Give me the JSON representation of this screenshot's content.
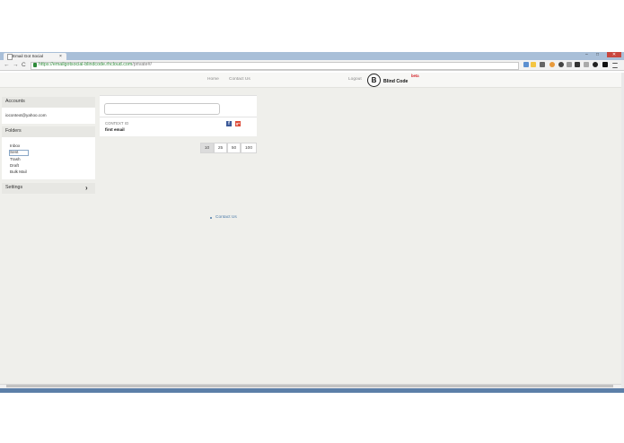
{
  "browser": {
    "tab_title": "Email Got Social",
    "tab_close": "×",
    "window_controls": [
      "–",
      "□"
    ],
    "window_close": "✕",
    "nav": [
      "←",
      "→",
      "C"
    ],
    "url_host": "https://emailgotsocial-blindcode.rhcloud.com",
    "url_path": "/private#/"
  },
  "header": {
    "home_label": "Home",
    "contact_label": "Contact Us",
    "logout_label": "Logout",
    "logo_mark": "B",
    "logo_text": "Blind Code",
    "beta_label": "beta"
  },
  "sidebar": {
    "accounts_header": "Accounts",
    "account_email": "iocontext@yahoo.com",
    "folders_header": "Folders",
    "folders": [
      "Inbox",
      "Sent",
      "Trash",
      "Draft",
      "Bulk Mail"
    ],
    "selected_folder": "Sent",
    "settings_label": "Settings",
    "settings_chevron": "›"
  },
  "main": {
    "search_value": "",
    "message": {
      "context_label": "CONTEXT IO",
      "subject": "first email",
      "share_facebook": "f",
      "share_google": "g+"
    },
    "page_sizes": [
      "10",
      "25",
      "50",
      "100"
    ],
    "active_page_size": "10"
  },
  "footer": {
    "contact_link": "Contact Us"
  },
  "colors": {
    "link": "#4a7aa8",
    "beta": "#d4232a",
    "facebook": "#3b5998",
    "google": "#dd4b39"
  }
}
